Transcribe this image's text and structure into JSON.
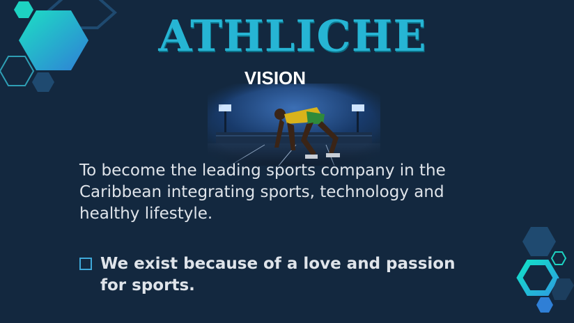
{
  "slide": {
    "title": "ATHLICHE",
    "subtitle": "VISION",
    "body_text": "To become the leading sports company in the Caribbean integrating sports, technology and healthy lifestyle.",
    "bullet_text": "We exist because of a love and passion for sports.",
    "image_subject": "sprinter in starting blocks in a floodlit stadium",
    "bullet_icon": "square-outline-icon"
  },
  "colors": {
    "background": "#13283f",
    "title": "#26b5d4",
    "body_text": "#dfe4ea",
    "accent_teal": "#1dd3c2",
    "accent_blue": "#2f7fd6",
    "hex_outline": "#1f4a70"
  }
}
